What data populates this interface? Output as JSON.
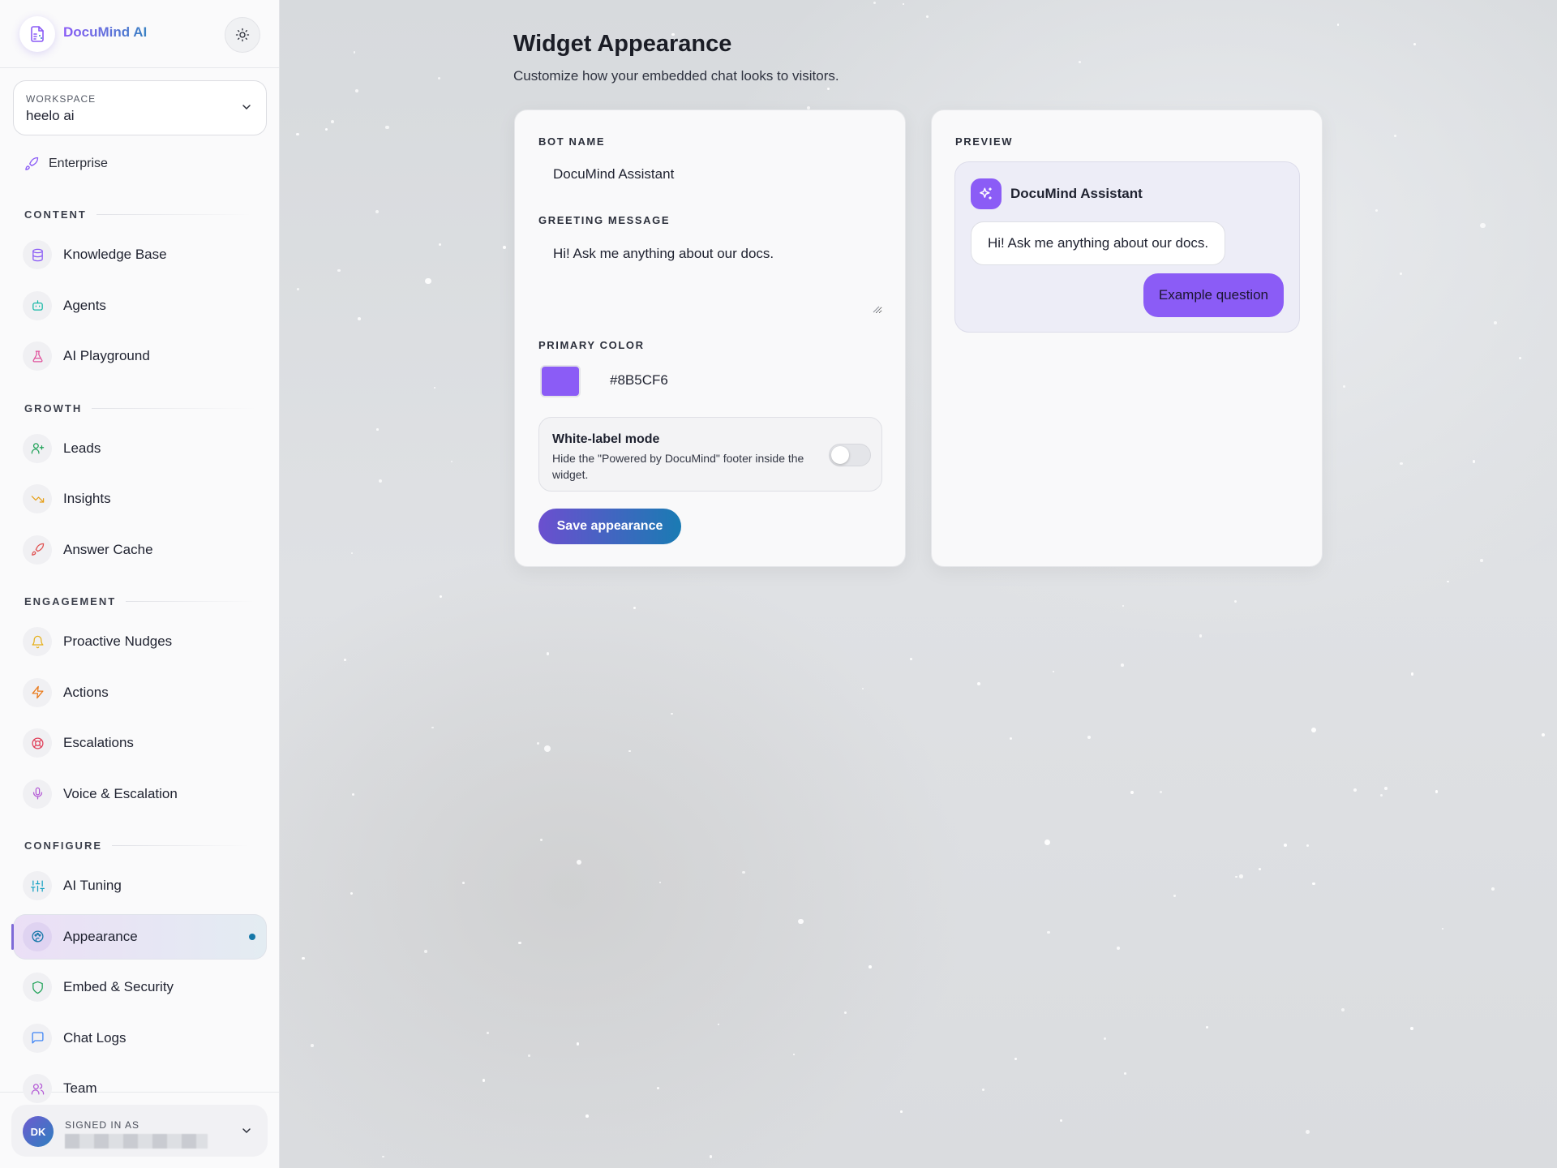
{
  "brand": {
    "name": "DocuMind AI"
  },
  "workspace": {
    "label": "WORKSPACE",
    "value": "heelo ai"
  },
  "plan": {
    "label": "Enterprise"
  },
  "sidebar": {
    "sections": [
      {
        "title": "CONTENT",
        "items": [
          {
            "label": "Knowledge Base",
            "icon": "database-icon",
            "color": "#8b5cf6"
          },
          {
            "label": "Agents",
            "icon": "bot-icon",
            "color": "#14b8a6"
          },
          {
            "label": "AI Playground",
            "icon": "flask-icon",
            "color": "#e0529c"
          }
        ]
      },
      {
        "title": "GROWTH",
        "items": [
          {
            "label": "Leads",
            "icon": "user-plus-icon",
            "color": "#22a35a"
          },
          {
            "label": "Insights",
            "icon": "trending-down-icon",
            "color": "#e6a01b"
          },
          {
            "label": "Answer Cache",
            "icon": "rocket-icon",
            "color": "#e05252"
          }
        ]
      },
      {
        "title": "ENGAGEMENT",
        "items": [
          {
            "label": "Proactive Nudges",
            "icon": "bell-icon",
            "color": "#e6b01b"
          },
          {
            "label": "Actions",
            "icon": "zap-icon",
            "color": "#ea7a1a"
          },
          {
            "label": "Escalations",
            "icon": "lifebuoy-icon",
            "color": "#e0405a"
          },
          {
            "label": "Voice & Escalation",
            "icon": "mic-icon",
            "color": "#b45ad6"
          }
        ]
      },
      {
        "title": "CONFIGURE",
        "items": [
          {
            "label": "AI Tuning",
            "icon": "sliders-icon",
            "color": "#1aa3c4"
          },
          {
            "label": "Appearance",
            "icon": "palette-icon",
            "color": "#1577a8",
            "active": true
          },
          {
            "label": "Embed & Security",
            "icon": "shield-icon",
            "color": "#22a35a"
          },
          {
            "label": "Chat Logs",
            "icon": "message-square-icon",
            "color": "#3b82f6"
          },
          {
            "label": "Team",
            "icon": "users-icon",
            "color": "#b45ad6"
          }
        ]
      }
    ]
  },
  "user": {
    "signed_in_label": "SIGNED IN AS",
    "initials": "DK"
  },
  "page": {
    "title": "Widget Appearance",
    "subtitle": "Customize how your embedded chat looks to visitors."
  },
  "form": {
    "bot_name_label": "BOT NAME",
    "bot_name_value": "DocuMind Assistant",
    "greeting_label": "GREETING MESSAGE",
    "greeting_value": "Hi! Ask me anything about our docs.",
    "primary_color_label": "PRIMARY COLOR",
    "primary_color_value": "#8B5CF6",
    "white_label_title": "White-label mode",
    "white_label_desc": "Hide the \"Powered by DocuMind\" footer inside the widget.",
    "white_label_on": false,
    "save_label": "Save appearance"
  },
  "preview": {
    "label": "PREVIEW",
    "bot_name": "DocuMind Assistant",
    "bot_message": "Hi! Ask me anything about our docs.",
    "user_message": "Example question"
  }
}
